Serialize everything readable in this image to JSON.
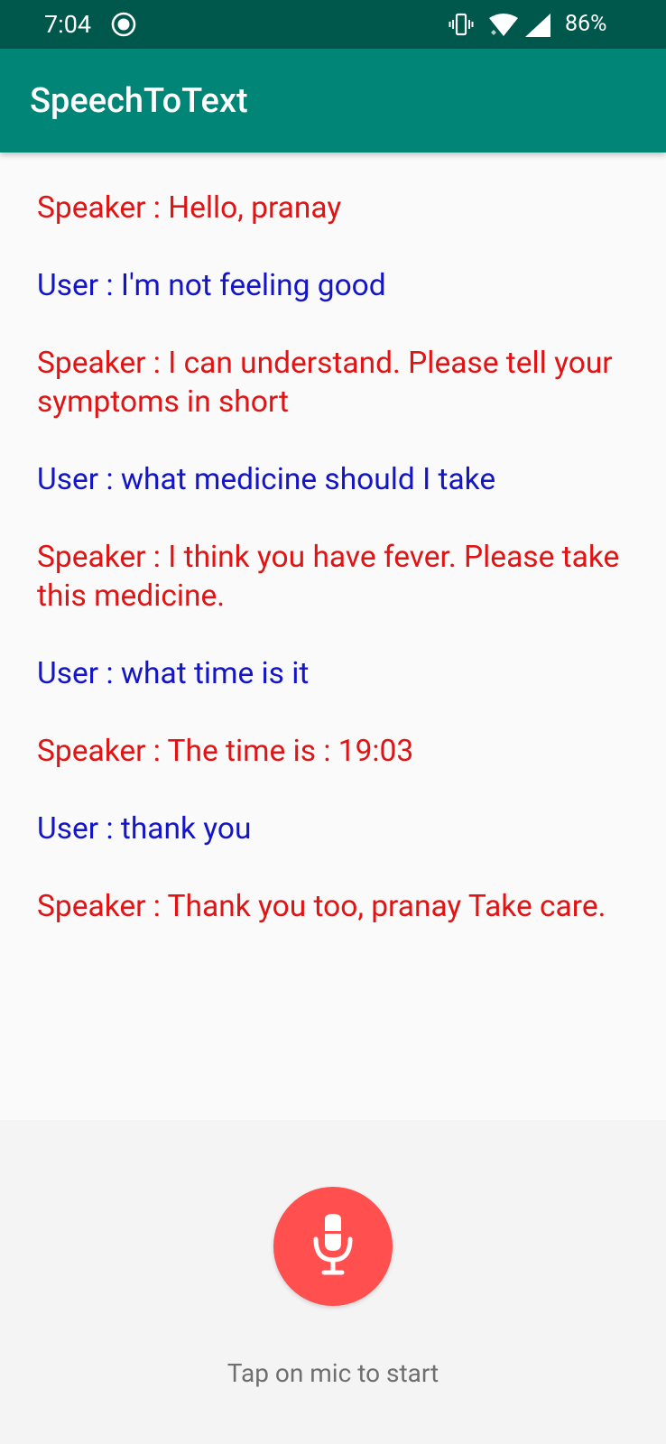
{
  "status_bar": {
    "time": "7:04",
    "battery": "86%",
    "icons": [
      "radio-button-icon",
      "vibrate-icon",
      "wifi-icon",
      "signal-icon"
    ]
  },
  "app_bar": {
    "title": "SpeechToText",
    "color": "#008577"
  },
  "messages": [
    {
      "role": "speaker",
      "text": "Speaker : Hello, pranay"
    },
    {
      "role": "user",
      "text": "User : I'm not feeling good"
    },
    {
      "role": "speaker",
      "text": "Speaker : I can understand. Please tell your symptoms in short"
    },
    {
      "role": "user",
      "text": "User : what medicine should I take"
    },
    {
      "role": "speaker",
      "text": "Speaker : I think you have fever. Please take this medicine."
    },
    {
      "role": "user",
      "text": "User : what time is it"
    },
    {
      "role": "speaker",
      "text": "Speaker : The time is : 19:03"
    },
    {
      "role": "user",
      "text": "User : thank you"
    },
    {
      "role": "speaker",
      "text": "Speaker : Thank you too, pranay Take care."
    }
  ],
  "colors": {
    "speaker": "#e01414",
    "user": "#1515c8",
    "mic_button": "#ff4f4f"
  },
  "mic": {
    "icon": "microphone-icon",
    "hint": "Tap on mic to start"
  }
}
